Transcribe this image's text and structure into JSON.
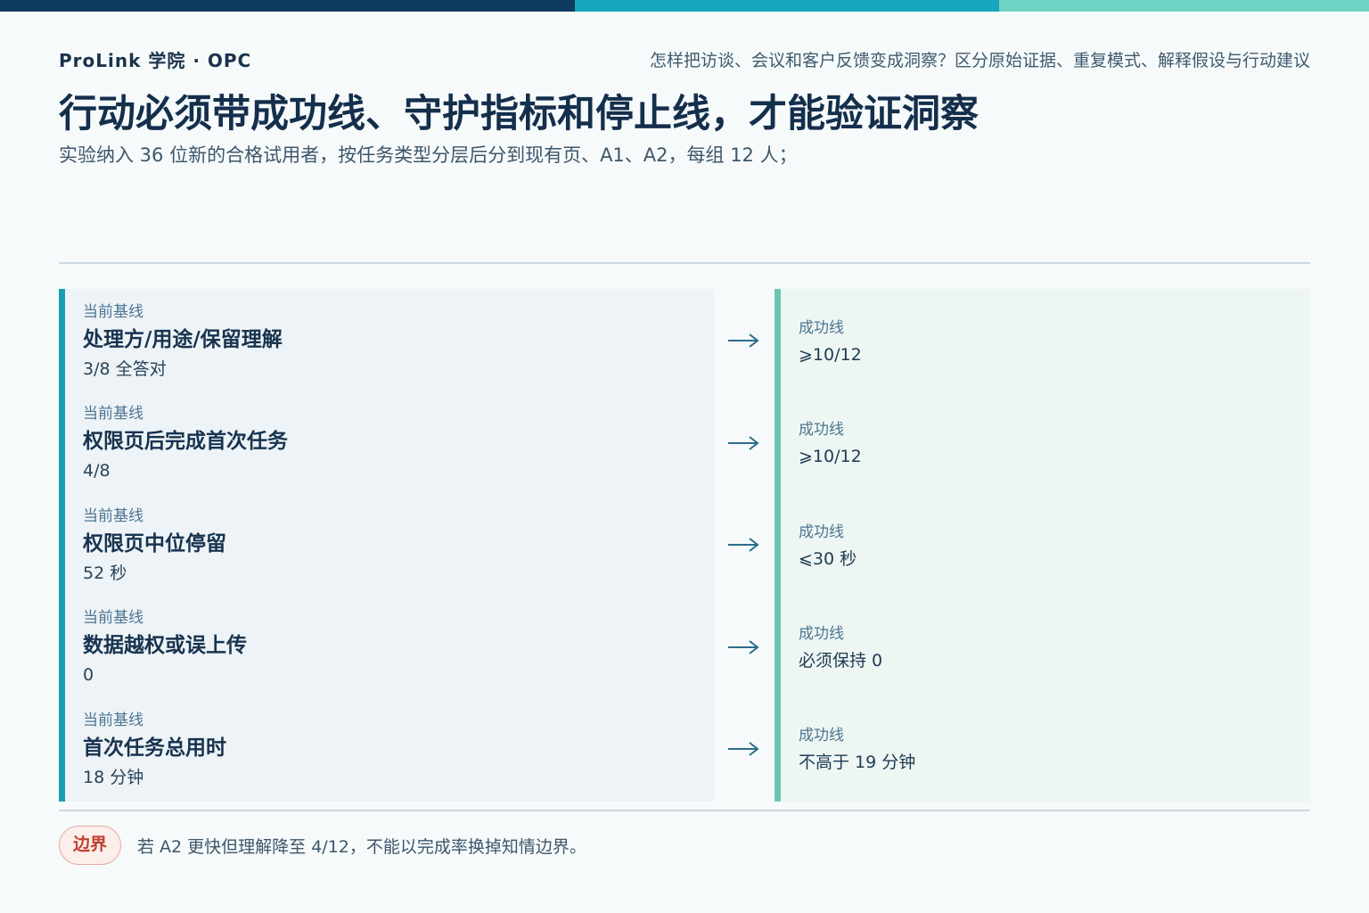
{
  "header": {
    "brand": "ProLink 学院 · OPC",
    "question": "怎样把访谈、会议和客户反馈变成洞察？区分原始证据、重复模式、解释假设与行动建议",
    "title": "行动必须带成功线、守护指标和停止线，才能验证洞察",
    "subtitle": "实验纳入 36 位新的合格试用者，按任务类型分层后分到现有页、A1、A2，每组 12 人；"
  },
  "rows": [
    {
      "baseline_label": "当前基线",
      "name": "处理方/用途/保留理解",
      "baseline_value": "3/8 全答对",
      "success_label": "成功线",
      "success_value": "⩾10/12"
    },
    {
      "baseline_label": "当前基线",
      "name": "权限页后完成首次任务",
      "baseline_value": "4/8",
      "success_label": "成功线",
      "success_value": "⩾10/12"
    },
    {
      "baseline_label": "当前基线",
      "name": "权限页中位停留",
      "baseline_value": "52 秒",
      "success_label": "成功线",
      "success_value": "⩽30 秒"
    },
    {
      "baseline_label": "当前基线",
      "name": "数据越权或误上传",
      "baseline_value": "0",
      "success_label": "成功线",
      "success_value": "必须保持 0"
    },
    {
      "baseline_label": "当前基线",
      "name": "首次任务总用时",
      "baseline_value": "18 分钟",
      "success_label": "成功线",
      "success_value": "不高于 19 分钟"
    }
  ],
  "arrow_glyph": "→",
  "boundary": {
    "badge": "边界",
    "text": "若 A2 更快但理解降至 4/12，不能以完成率换掉知情边界。"
  },
  "colors": {
    "bar_dark": "#0f3a5f",
    "bar_mid": "#16a6bd",
    "bar_light": "#6fd3c3",
    "baseline_accent": "#1b9db0",
    "success_accent": "#6cc4b2",
    "boundary_red": "#c0412f"
  },
  "icons": [
    "right-arrow-icon"
  ]
}
